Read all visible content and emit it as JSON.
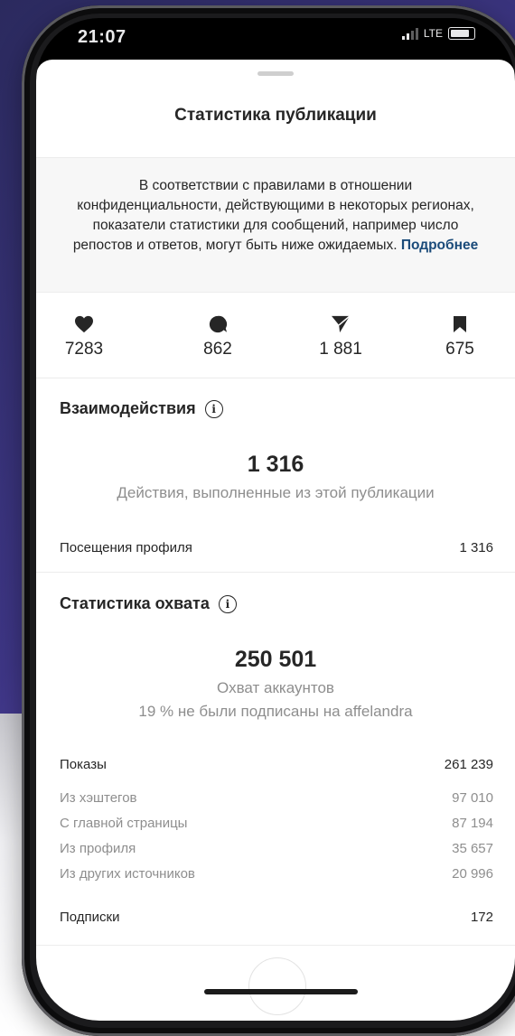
{
  "status": {
    "time": "21:07",
    "network": "LTE"
  },
  "sheet": {
    "title": "Статистика публикации",
    "notice_text": "В соответствии с правилами в отношении конфиденциальности, действующими в некоторых регионах, показатели статистики для сообщений, например число репостов и ответов, могут быть ниже ожидаемых.",
    "notice_link": "Подробнее"
  },
  "metrics": [
    {
      "icon": "heart-icon",
      "value": "7283"
    },
    {
      "icon": "comment-icon",
      "value": "862"
    },
    {
      "icon": "share-icon",
      "value": "1 881"
    },
    {
      "icon": "bookmark-icon",
      "value": "675"
    }
  ],
  "interactions": {
    "title": "Взаимодействия",
    "total": "1 316",
    "caption": "Действия, выполненные из этой публикации",
    "rows": [
      {
        "label": "Посещения профиля",
        "value": "1 316"
      }
    ]
  },
  "reach": {
    "title": "Статистика охвата",
    "total": "250 501",
    "caption": "Охват аккаунтов",
    "caption2": "19 % не были подписаны на affelandra",
    "impressions": {
      "label": "Показы",
      "value": "261 239"
    },
    "sources": [
      {
        "label": "Из хэштегов",
        "value": "97 010"
      },
      {
        "label": "С главной страницы",
        "value": "87 194"
      },
      {
        "label": "Из профиля",
        "value": "35 657"
      },
      {
        "label": "Из других источников",
        "value": "20 996"
      }
    ],
    "follows": {
      "label": "Подписки",
      "value": "172"
    }
  },
  "colors": {
    "link": "#1b4b7a",
    "text": "#262626",
    "muted": "#8e8e8e",
    "background_accent": "#3e3686"
  }
}
